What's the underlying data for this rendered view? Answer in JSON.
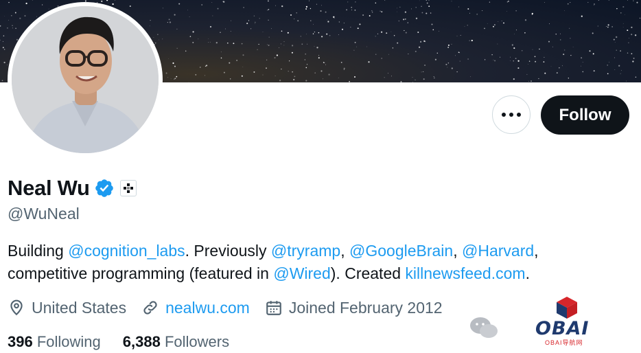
{
  "profile": {
    "name": "Neal Wu",
    "handle": "@WuNeal",
    "follow_label": "Follow",
    "bio": {
      "t1": "Building ",
      "m1": "@cognition_labs",
      "t2": ". Previously ",
      "m2": "@tryramp",
      "t3": ", ",
      "m3": "@GoogleBrain",
      "t4": ", ",
      "m4": "@Harvard",
      "t5": ",",
      "t6": "competitive programming (featured in ",
      "m5": "@Wired",
      "t7": "). Created ",
      "m6": "killnewsfeed.com",
      "t8": "."
    },
    "location": "United States",
    "website": "nealwu.com",
    "joined": "Joined February 2012",
    "following_count": "396",
    "following_label": "Following",
    "followers_count": "6,388",
    "followers_label": "Followers"
  },
  "watermark": {
    "brand": "OBAI",
    "sub": "OBAI导航网"
  },
  "colors": {
    "link": "#1d9bf0",
    "text": "#0f1419",
    "secondary": "#536471",
    "button_dark": "#0f1419",
    "verified": "#1d9bf0",
    "watermark_red": "#d7262b",
    "watermark_navy": "#1f3a6e"
  },
  "icons": {
    "more": "ellipsis-icon",
    "verified": "verified-badge-icon",
    "affiliation": "affiliate-badge-icon",
    "location": "location-pin-icon",
    "website": "link-icon",
    "joined": "calendar-icon"
  }
}
